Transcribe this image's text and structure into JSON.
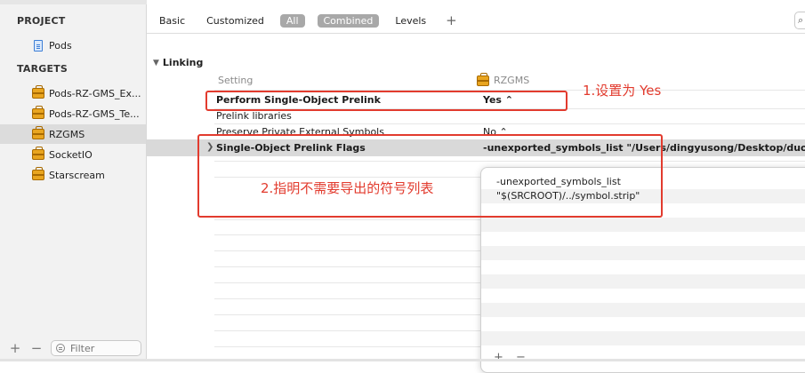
{
  "sidebar": {
    "project_header": "PROJECT",
    "project_items": [
      {
        "label": "Pods",
        "icon": "file-icon"
      }
    ],
    "targets_header": "TARGETS",
    "target_items": [
      {
        "label": "Pods-RZ-GMS_Ex...",
        "icon": "package-icon"
      },
      {
        "label": "Pods-RZ-GMS_Te...",
        "icon": "package-icon"
      },
      {
        "label": "RZGMS",
        "icon": "package-icon",
        "selected": true
      },
      {
        "label": "SocketIO",
        "icon": "package-icon"
      },
      {
        "label": "Starscream",
        "icon": "package-icon"
      }
    ],
    "add_button": "+",
    "remove_button": "−",
    "filter_placeholder": "Filter"
  },
  "tabs": {
    "basic": "Basic",
    "customized": "Customized",
    "all": "All",
    "combined": "Combined",
    "levels": "Levels",
    "add": "+",
    "search_icon": "⌕"
  },
  "settings": {
    "section_title": "Linking",
    "column_setting": "Setting",
    "column_target": "RZGMS",
    "rows": [
      {
        "label": "Perform Single-Object Prelink",
        "value": "Yes ⌃"
      },
      {
        "label": "Prelink libraries",
        "value": ""
      },
      {
        "label": "Preserve Private External Symbols",
        "value": "No ⌃"
      },
      {
        "label": "Single-Object Prelink Flags",
        "value": "-unexported_symbols_list \"/Users/dingyusong/Desktop/duobei/t"
      }
    ]
  },
  "popover": {
    "lines": [
      "-unexported_symbols_list",
      "\"$(SRCROOT)/../symbol.strip\""
    ],
    "add_button": "+",
    "remove_button": "−"
  },
  "annotations": {
    "note1": "1.设置为 Yes",
    "note2": "2.指明不需要导出的符号列表"
  },
  "colors": {
    "annotation": "#e23b2e",
    "selected_row": "#d9d9d9",
    "tab_active": "#a8a8a8"
  }
}
